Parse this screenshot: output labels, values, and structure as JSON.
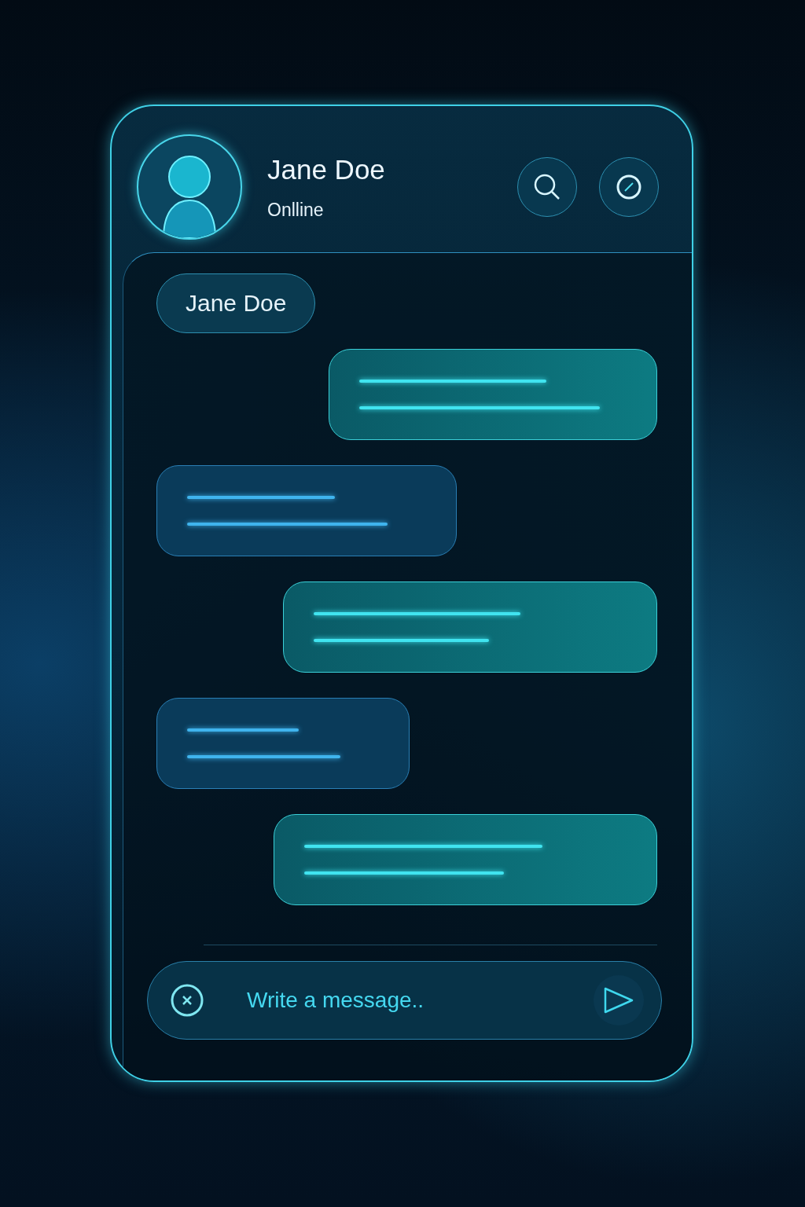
{
  "contact": {
    "name": "Jane Doe",
    "status": "Onlline"
  },
  "header_actions": [
    {
      "kind": "search"
    },
    {
      "kind": "compass"
    }
  ],
  "name_chip": "Jane Doe",
  "messages": [
    {
      "kind": "sent"
    },
    {
      "kind": "received"
    },
    {
      "kind": "sent"
    },
    {
      "kind": "received"
    },
    {
      "kind": "sent"
    }
  ],
  "composer": {
    "placeholder": "Write a message.."
  }
}
